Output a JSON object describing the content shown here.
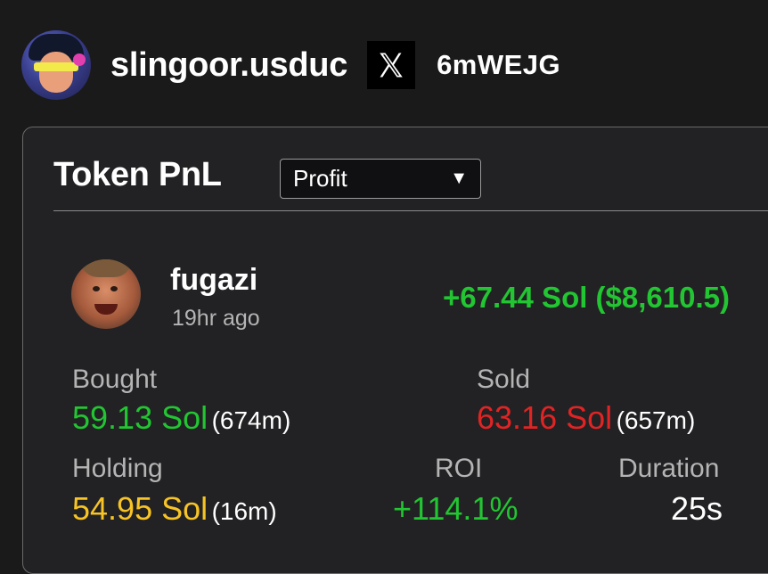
{
  "profile": {
    "username": "slingoor.usduc",
    "handle": "6mWEJG",
    "avatar_icon": "profile-avatar",
    "x_icon": "x-logo-icon"
  },
  "card": {
    "title": "Token PnL",
    "filter": {
      "selected": "Profit",
      "caret": "▼"
    }
  },
  "token": {
    "name": "fugazi",
    "time_ago": "19hr ago",
    "avatar_icon": "token-avatar",
    "pnl": "+67.44 Sol ($8,610.5)"
  },
  "stats": {
    "bought": {
      "label": "Bought",
      "value": "59.13 Sol",
      "detail": "(674m)"
    },
    "sold": {
      "label": "Sold",
      "value": "63.16 Sol",
      "detail": "(657m)"
    },
    "holding": {
      "label": "Holding",
      "value": "54.95 Sol",
      "detail": "(16m)"
    },
    "roi": {
      "label": "ROI",
      "value": "+114.1%"
    },
    "duration": {
      "label": "Duration",
      "value": "25s"
    }
  },
  "colors": {
    "background": "#1a1a1b",
    "positive": "#22c532",
    "negative": "#e02424",
    "holding": "#f7c325",
    "muted": "#b4b4b4"
  }
}
